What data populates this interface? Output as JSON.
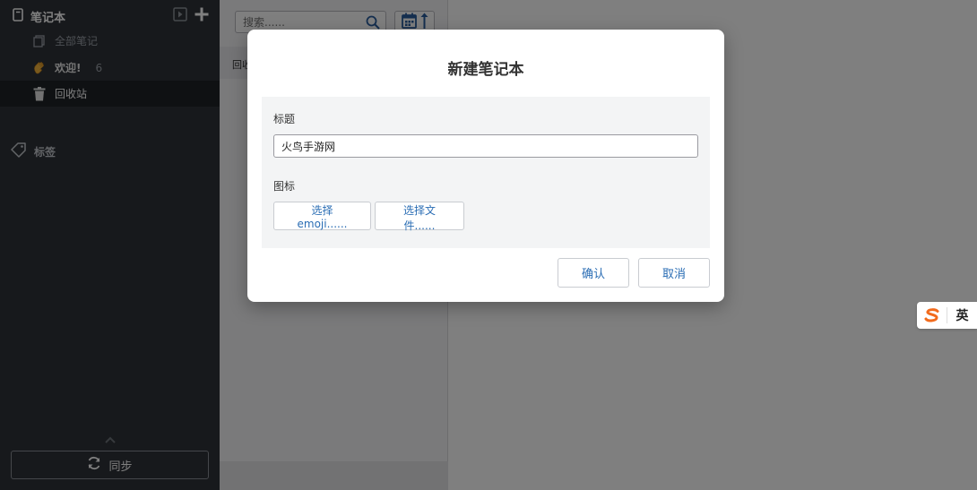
{
  "sidebar": {
    "notebooks_label": "笔记本",
    "items": [
      {
        "label": "全部笔记",
        "count": ""
      },
      {
        "label": "欢迎!",
        "count": "6"
      },
      {
        "label": "回收站",
        "count": ""
      }
    ],
    "tags_label": "标签",
    "sync_label": "同步"
  },
  "notelist": {
    "search_placeholder": "搜索......",
    "row_text": "回收"
  },
  "modal": {
    "title": "新建笔记本",
    "title_field_label": "标题",
    "title_value": "火鸟手游网",
    "icon_field_label": "图标",
    "pick_emoji_label": "选择 emoji......",
    "pick_file_label": "选择文件......",
    "confirm_label": "确认",
    "cancel_label": "取消"
  },
  "ime": {
    "lang": "英"
  },
  "colors": {
    "sidebar_bg": "#2f3238",
    "accent_blue": "#2a6db4",
    "ime_orange": "#f26b1d"
  }
}
